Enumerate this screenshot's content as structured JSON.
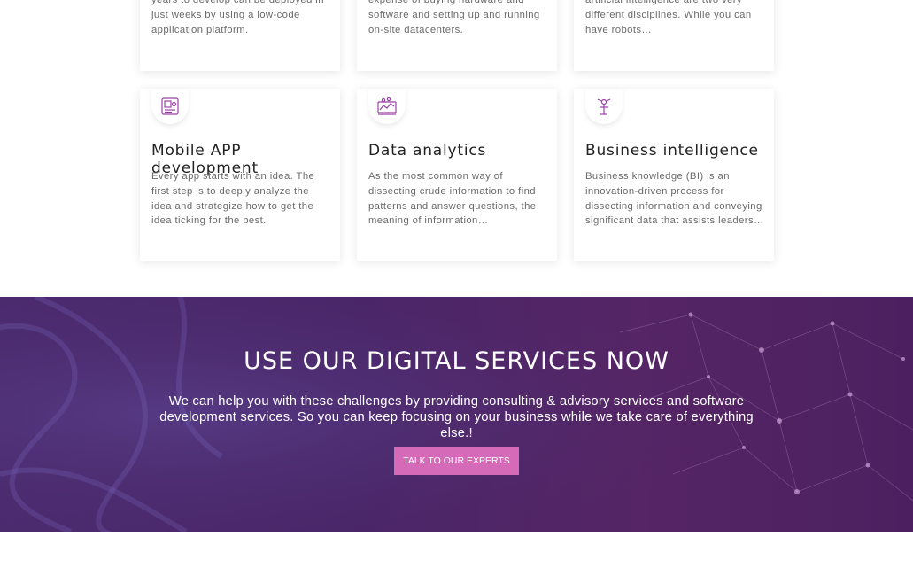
{
  "top_cards": [
    {
      "text": "years to develop can be deployed in just weeks by using a low-code application platform."
    },
    {
      "text": "expense of buying hardware and software and setting up and running on-site datacenters."
    },
    {
      "text": "artificial intelligence are two very different disciplines. While you can have robots…"
    }
  ],
  "cards": [
    {
      "icon": "mobile-app-icon",
      "title": "Mobile APP development",
      "text": "Every app starts with an idea. The first step is to deeply analyze the idea and strategize how to get the idea ticking for the best."
    },
    {
      "icon": "data-analytics-icon",
      "title": "Data analytics",
      "text": "As the most common way of dissecting crude information to find patterns and answer questions, the meaning of information…"
    },
    {
      "icon": "business-intelligence-icon",
      "title": "Business intelligence",
      "text": "Business knowledge (BI) is an innovation-driven process for dissecting information and conveying significant data that assists leaders…"
    }
  ],
  "banner": {
    "heading": "USE OUR DIGITAL SERVICES NOW",
    "subtext": "We can help you with these challenges by providing consulting & advisory services and software development services. So you can keep focusing on your business while we take care of everything else.!",
    "cta_label": "TALK TO OUR EXPERTS"
  },
  "colors": {
    "accent": "#d46ab8",
    "icon": "#9b3fa8",
    "banner_bg": "#4b2a6e"
  }
}
